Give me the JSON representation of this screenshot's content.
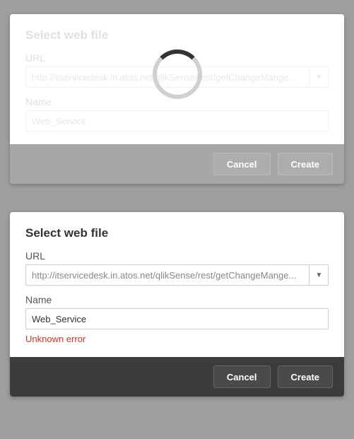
{
  "dialog_loading": {
    "title": "Select web file",
    "url_label": "URL",
    "url_value": "http://itservicedesk.in.atos.net/qlikSense/rest/getChangeMange...",
    "name_label": "Name",
    "name_value": "Web_Service",
    "cancel_label": "Cancel",
    "create_label": "Create"
  },
  "dialog_error": {
    "title": "Select web file",
    "url_label": "URL",
    "url_value": "http://itservicedesk.in.atos.net/qlikSense/rest/getChangeMange...",
    "name_label": "Name",
    "name_value": "Web_Service",
    "error_message": "Unknown error",
    "cancel_label": "Cancel",
    "create_label": "Create"
  }
}
